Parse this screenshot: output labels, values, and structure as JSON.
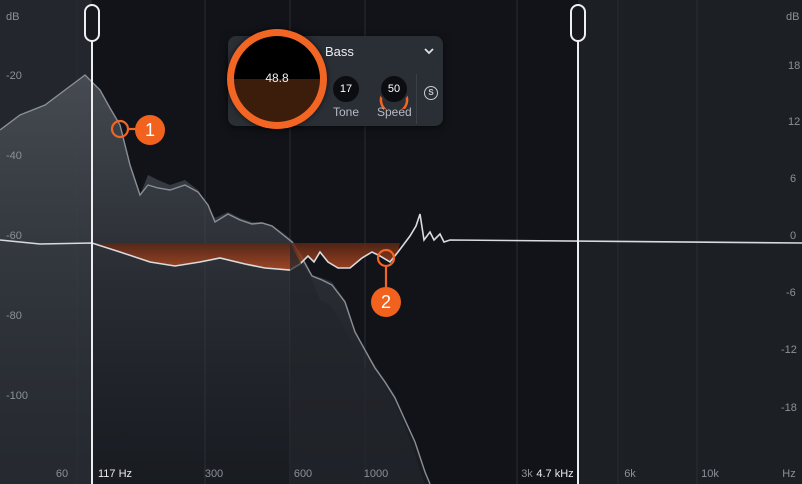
{
  "axes": {
    "db_unit": "dB",
    "db_left": [
      "-20",
      "-40",
      "-60",
      "-80",
      "-100"
    ],
    "db_right": [
      "18",
      "12",
      "6",
      "0",
      "-6",
      "-12",
      "-18"
    ],
    "db_right_unit": "dB",
    "freq_unit": "Hz",
    "freq_ticks": [
      "60",
      "300",
      "600",
      "1000",
      "3k",
      "6k",
      "10k"
    ]
  },
  "band": {
    "low_cutoff": "117 Hz",
    "high_cutoff": "4.7 kHz"
  },
  "markers": [
    "1",
    "2"
  ],
  "panel": {
    "band_name": "Bass",
    "amount": "48.8",
    "tone_value": "17",
    "tone_label": "Tone",
    "speed_value": "50",
    "speed_label": "Speed",
    "solo_label": "S"
  },
  "colors": {
    "accent": "#f26522",
    "background": "#14161b",
    "band_region": "#111318",
    "handle": "#eceef2"
  },
  "icons": [
    "chevron-down-icon",
    "solo-icon"
  ]
}
